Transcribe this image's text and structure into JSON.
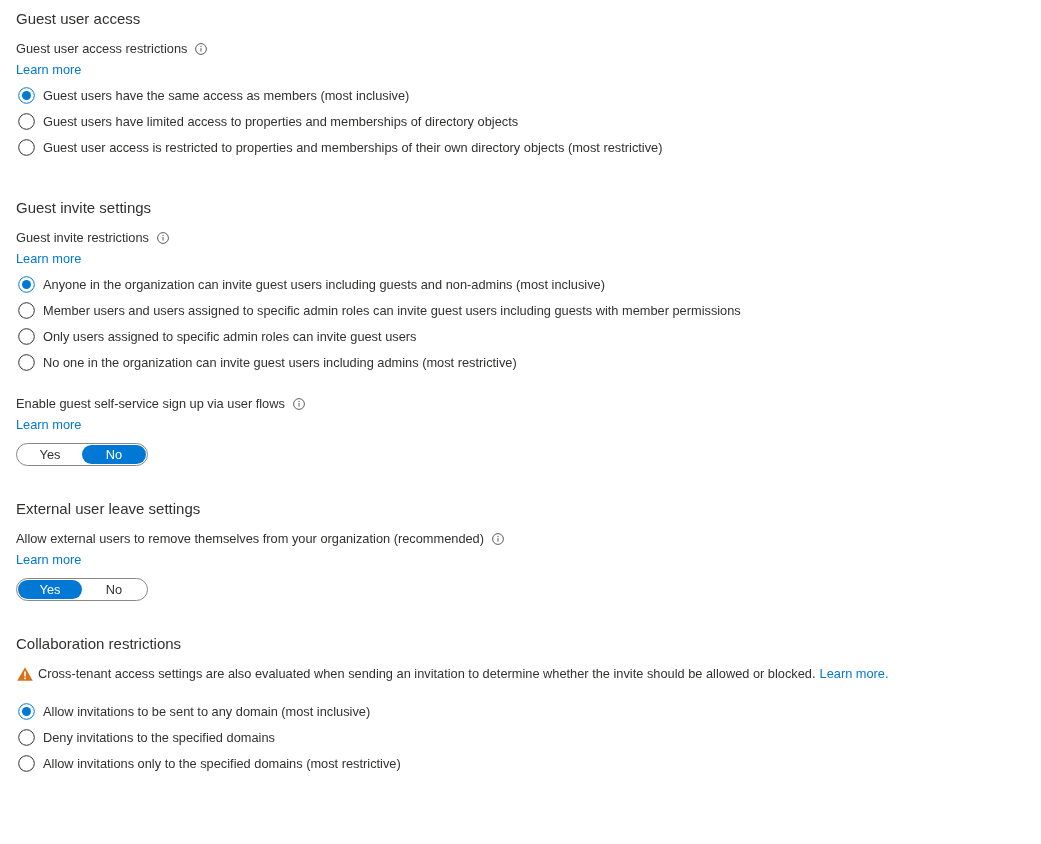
{
  "sections": [
    {
      "title": "Guest user access",
      "settings": [
        {
          "kind": "radio",
          "label": "Guest user access restrictions",
          "info_icon": true,
          "link": "Learn more",
          "options": [
            {
              "label": "Guest users have the same access as members (most inclusive)",
              "selected": true
            },
            {
              "label": "Guest users have limited access to properties and memberships of directory objects",
              "selected": false
            },
            {
              "label": "Guest user access is restricted to properties and memberships of their own directory objects (most restrictive)",
              "selected": false
            }
          ]
        }
      ]
    },
    {
      "title": "Guest invite settings",
      "settings": [
        {
          "kind": "radio",
          "label": "Guest invite restrictions",
          "info_icon": true,
          "link": "Learn more",
          "options": [
            {
              "label": "Anyone in the organization can invite guest users including guests and non-admins (most inclusive)",
              "selected": true
            },
            {
              "label": "Member users and users assigned to specific admin roles can invite guest users including guests with member permissions",
              "selected": false
            },
            {
              "label": "Only users assigned to specific admin roles can invite guest users",
              "selected": false
            },
            {
              "label": "No one in the organization can invite guest users including admins (most restrictive)",
              "selected": false
            }
          ]
        },
        {
          "kind": "toggle",
          "label": "Enable guest self-service sign up via user flows",
          "info_icon": true,
          "link": "Learn more",
          "options": [
            {
              "label": "Yes",
              "selected": false
            },
            {
              "label": "No",
              "selected": true
            }
          ]
        }
      ]
    },
    {
      "title": "External user leave settings",
      "settings": [
        {
          "kind": "toggle",
          "label": "Allow external users to remove themselves from your organization (recommended)",
          "info_icon": true,
          "link": "Learn more",
          "options": [
            {
              "label": "Yes",
              "selected": true
            },
            {
              "label": "No",
              "selected": false
            }
          ]
        }
      ]
    },
    {
      "title": "Collaboration restrictions",
      "settings": [
        {
          "kind": "notice",
          "text": "Cross-tenant access settings are also evaluated when sending an invitation to determine whether the invite should be allowed or blocked.",
          "link": "Learn more."
        },
        {
          "kind": "radio",
          "options": [
            {
              "label": "Allow invitations to be sent to any domain (most inclusive)",
              "selected": true
            },
            {
              "label": "Deny invitations to the specified domains",
              "selected": false
            },
            {
              "label": "Allow invitations only to the specified domains (most restrictive)",
              "selected": false
            }
          ]
        }
      ]
    }
  ]
}
